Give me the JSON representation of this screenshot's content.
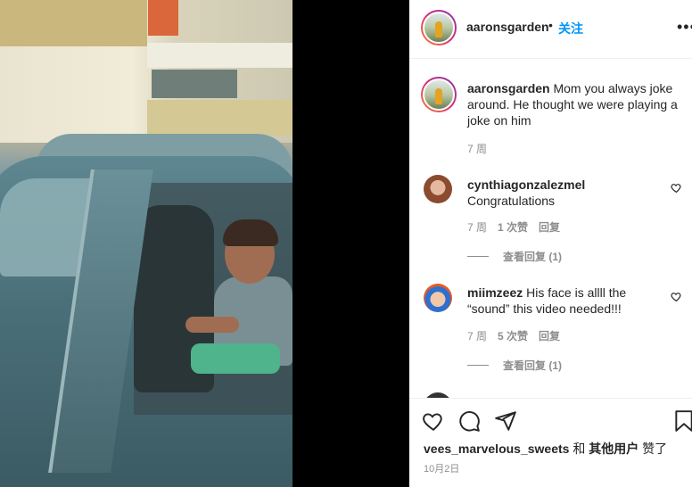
{
  "post": {
    "username": "aaronsgarden",
    "separator": "•",
    "follow_label": "关注",
    "more_label": "•••"
  },
  "caption": {
    "username": "aaronsgarden",
    "text": "Mom you always joke around. He thought we were playing a joke on him",
    "time": "7 周"
  },
  "comments": [
    {
      "username": "cynthiagonzalezmel",
      "text": "Congratulations",
      "time": "7 周",
      "likes": "1 次赞",
      "reply_label": "回复",
      "view_replies": "查看回复 (1)"
    },
    {
      "username": "miimzeez",
      "text": "His face is allll the “sound” this video needed!!!",
      "time": "7 周",
      "likes": "5 次赞",
      "reply_label": "回复",
      "view_replies": "查看回复 (1)"
    }
  ],
  "footer": {
    "liked_by_user": "vees_marvelous_sweets",
    "liked_and": " 和 ",
    "liked_others": "其他用户",
    "liked_suffix": " 赞了",
    "date": "10月2日"
  },
  "icons": {
    "like": "heart-icon",
    "comment": "comment-icon",
    "share": "share-icon",
    "save": "bookmark-icon",
    "more": "more-icon",
    "comment_like": "heart-icon"
  },
  "colors": {
    "accent": "#0095f6",
    "text": "#262626",
    "muted": "#8e8e8e"
  }
}
